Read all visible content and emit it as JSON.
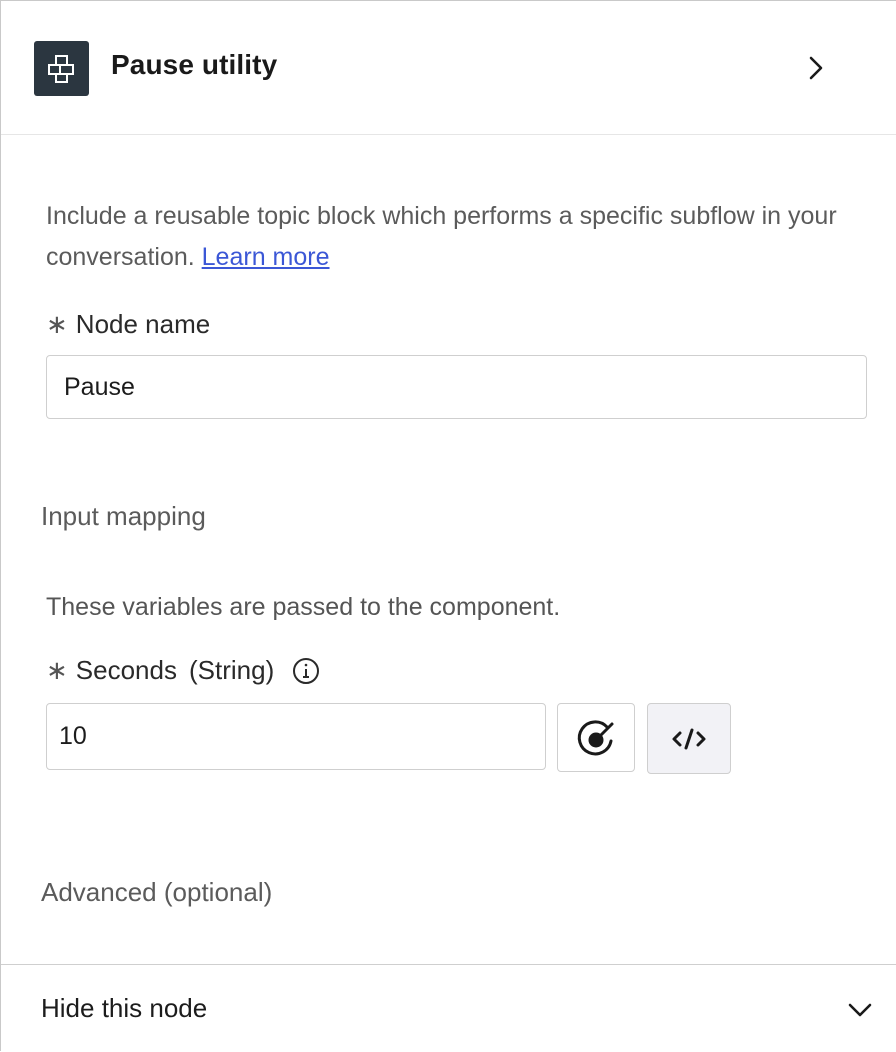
{
  "header": {
    "title": "Pause utility",
    "icon": "component-grid-icon",
    "expand_icon": "chevron-right-icon"
  },
  "description": {
    "text": "Include a reusable topic block which performs a specific subflow in your conversation.",
    "link_label": "Learn more"
  },
  "node_name": {
    "required_marker": "∗",
    "label": "Node name",
    "value": "Pause"
  },
  "input_mapping": {
    "title": "Input mapping",
    "description": "These variables are passed to the component.",
    "fields": [
      {
        "required_marker": "∗",
        "label": "Seconds",
        "type": "(String)",
        "info_icon": "info-circle-icon",
        "value": "10",
        "variable_icon": "variable-picker-icon",
        "code_icon": "code-icon"
      }
    ]
  },
  "advanced": {
    "title": "Advanced (optional)"
  },
  "footer": {
    "label": "Hide this node",
    "toggle_icon": "chevron-down-icon"
  },
  "colors": {
    "icon_tile": "#2b3640",
    "link": "#3b57d6",
    "code_button_bg": "#f2f2f6"
  }
}
